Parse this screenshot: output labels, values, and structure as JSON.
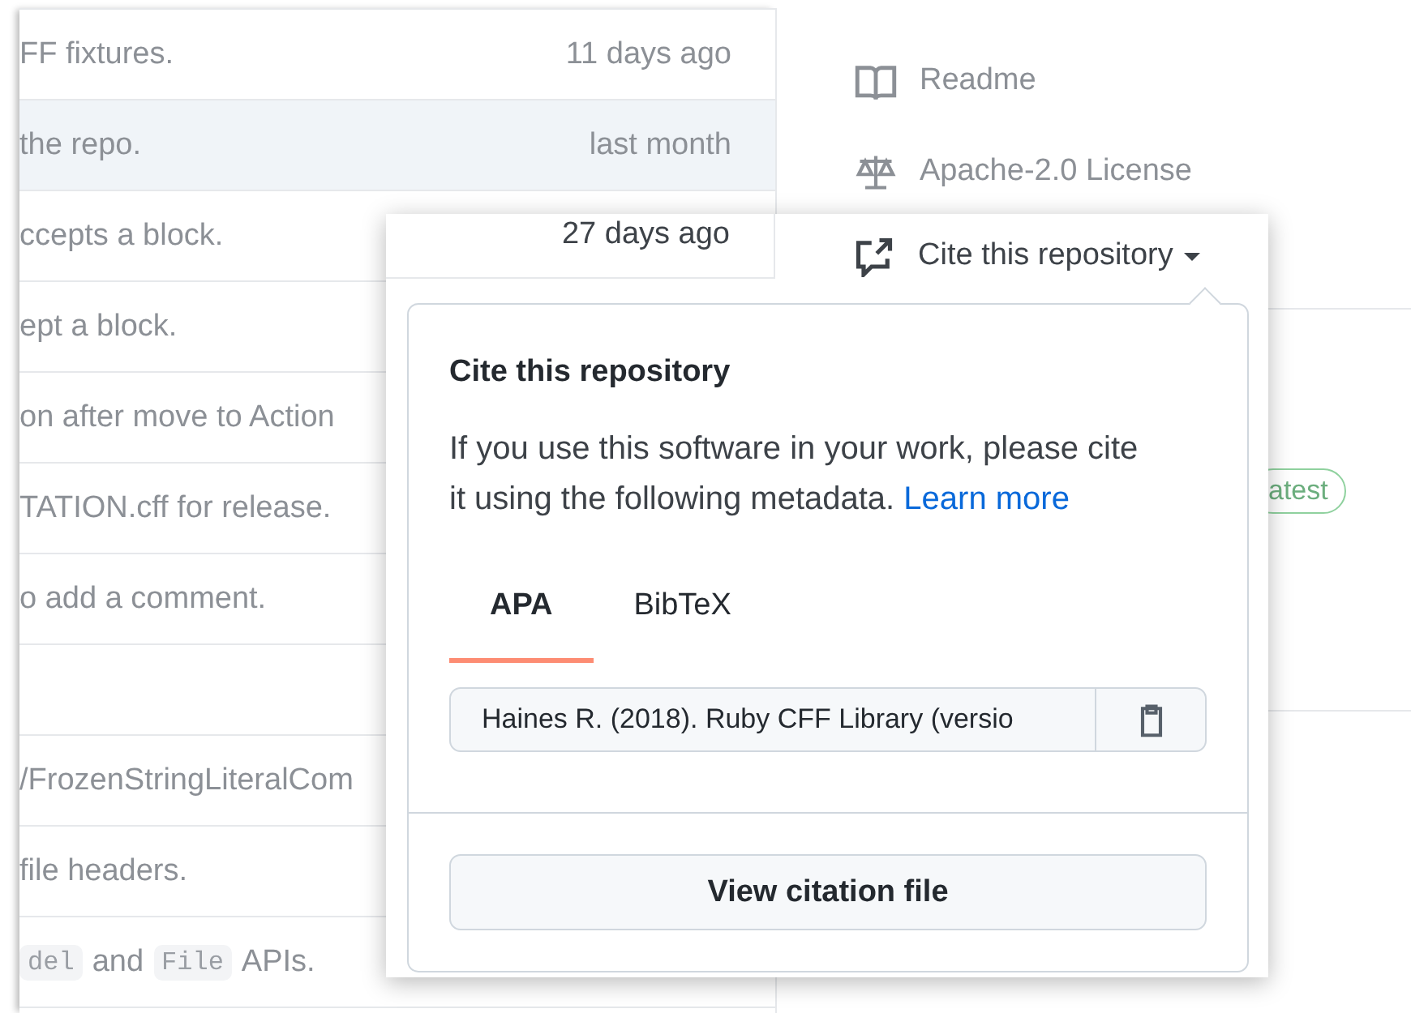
{
  "commits": [
    {
      "message": [
        {
          "kind": "text",
          "text": "FF fixtures."
        }
      ],
      "time": "11 days ago",
      "hovered": false
    },
    {
      "message": [
        {
          "kind": "text",
          "text": "the repo."
        }
      ],
      "time": "last month",
      "hovered": true
    },
    {
      "message": [
        {
          "kind": "text",
          "text": "ccepts a block."
        }
      ],
      "hovered": false
    },
    {
      "message": [
        {
          "kind": "text",
          "text": "ept a block."
        }
      ],
      "hovered": false
    },
    {
      "message": [
        {
          "kind": "text",
          "text": "on after move to Action"
        }
      ],
      "hovered": false
    },
    {
      "message": [
        {
          "kind": "text",
          "text": "TATION.cff for release."
        }
      ],
      "hovered": false
    },
    {
      "message": [
        {
          "kind": "text",
          "text": "o add a comment."
        }
      ],
      "hovered": false
    },
    {
      "hovered": false
    },
    {
      "message": [
        {
          "kind": "text",
          "text": "/FrozenStringLiteralCom"
        }
      ],
      "hovered": false
    },
    {
      "message": [
        {
          "kind": "text",
          "text": "file headers."
        }
      ],
      "hovered": false
    },
    {
      "message": [
        {
          "kind": "code",
          "text": "del"
        },
        {
          "kind": "text",
          "text": "and"
        },
        {
          "kind": "code",
          "text": "File"
        },
        {
          "kind": "text",
          "text": "APIs."
        }
      ],
      "hovered": false
    }
  ],
  "sidebar": {
    "links": [
      {
        "label": "Readme"
      },
      {
        "label": "Apache-2.0 License"
      }
    ],
    "release_badge": "atest"
  },
  "cite_popover": {
    "time": "27 days ago",
    "trigger": "Cite this repository",
    "title": "Cite this repository",
    "text": "If you use this software in your work, please cite it using the following metadata.",
    "link": "Learn more",
    "tabs": [
      {
        "label": "APA",
        "selected": true
      },
      {
        "label": "BibTeX",
        "selected": false
      }
    ],
    "citation": "Haines R. (2018). Ruby CFF Library (versio",
    "button": "View citation file"
  }
}
